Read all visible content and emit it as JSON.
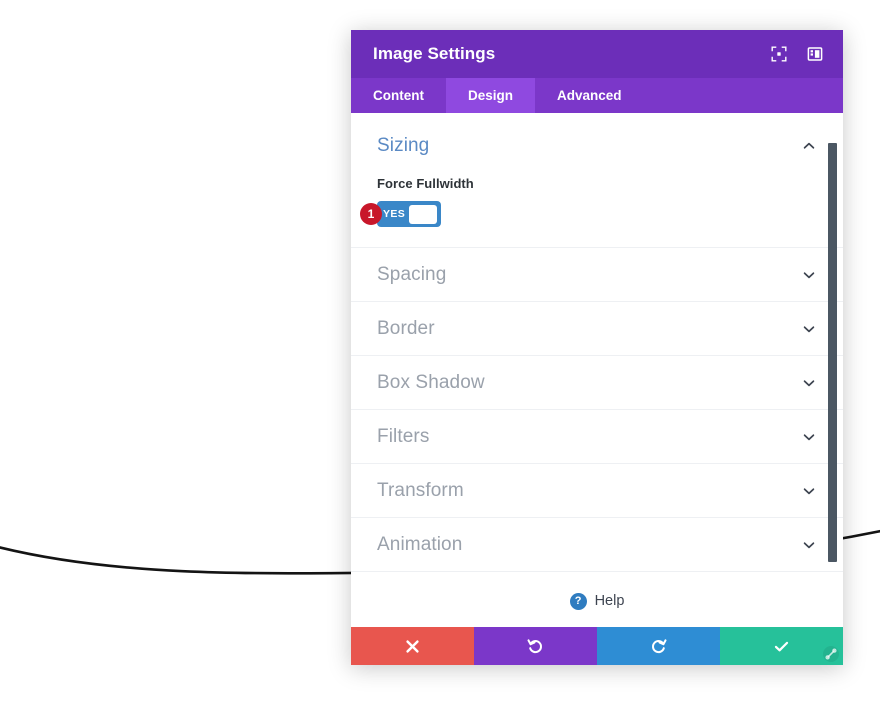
{
  "modal": {
    "title": "Image Settings",
    "header_icons": [
      {
        "name": "fullscreen-icon",
        "glyph": "expand"
      },
      {
        "name": "layout-panel-icon",
        "glyph": "panel"
      }
    ],
    "tabs": [
      {
        "label": "Content",
        "active": false
      },
      {
        "label": "Design",
        "active": true
      },
      {
        "label": "Advanced",
        "active": false
      }
    ],
    "open_section": {
      "title": "Sizing",
      "expanded": true,
      "chevron": "chevron-up",
      "fields": [
        {
          "label": "Force Fullwidth",
          "type": "toggle",
          "value": "YES",
          "state_on": true,
          "step_badge": "1"
        }
      ]
    },
    "collapsed_sections": [
      {
        "title": "Spacing",
        "chevron": "chevron-down"
      },
      {
        "title": "Border",
        "chevron": "chevron-down"
      },
      {
        "title": "Box Shadow",
        "chevron": "chevron-down"
      },
      {
        "title": "Filters",
        "chevron": "chevron-down"
      },
      {
        "title": "Transform",
        "chevron": "chevron-down"
      },
      {
        "title": "Animation",
        "chevron": "chevron-down"
      }
    ],
    "help": {
      "label": "Help",
      "icon_glyph": "?"
    },
    "footer_buttons": [
      {
        "name": "cancel-button",
        "icon": "close-x-icon",
        "color": "#e8564e"
      },
      {
        "name": "undo-button",
        "icon": "undo-icon",
        "color": "#7b37c9"
      },
      {
        "name": "redo-button",
        "icon": "redo-icon",
        "color": "#2e8dd4"
      },
      {
        "name": "save-button",
        "icon": "check-icon",
        "color": "#26c19a"
      }
    ],
    "scrollbar": {
      "color": "#4b5763"
    }
  },
  "colors": {
    "header_purple": "#6c2eb9",
    "tab_purple": "#7b37c9",
    "tab_active_purple": "#8f49e0",
    "toggle_blue": "#3a87c8",
    "badge_red": "#c8172a",
    "section_open_blue": "#5b8ac4",
    "section_muted": "#9aa1ab"
  }
}
